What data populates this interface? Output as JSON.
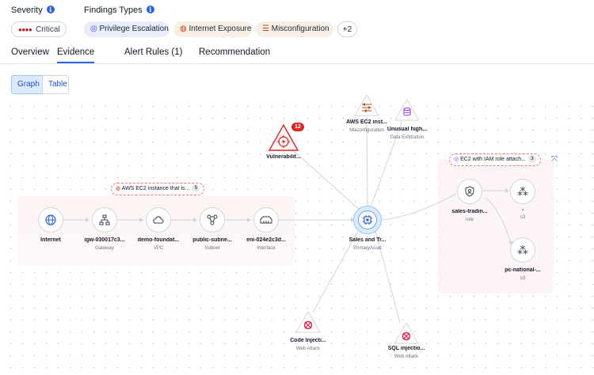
{
  "header": {
    "severity_label": "Severity",
    "findings_label": "Findings Types",
    "severity_value": "Critical",
    "findings": [
      "Privilege Escalation",
      "Internet Exposure",
      "Misconfiguration"
    ],
    "more_count": "+2"
  },
  "tabs": [
    "Overview",
    "Evidence",
    "Alert Rules (1)",
    "Recommendation"
  ],
  "active_tab": "Evidence",
  "view_toggle": {
    "graph": "Graph",
    "table": "Table",
    "active": "Graph"
  },
  "graph": {
    "network_group_label": "AWS EC2 instance that is...",
    "network_group_count": "5",
    "iam_group_label": "EC2 with IAM role attach...",
    "iam_group_count": "3",
    "nodes": {
      "internet": {
        "name": "Internet"
      },
      "gateway": {
        "name": "igw-030017c3...",
        "type": "Gateway"
      },
      "vpc": {
        "name": "demo-foundat...",
        "type": "VPC"
      },
      "subnet": {
        "name": "public-subne...",
        "type": "Subnet"
      },
      "interface": {
        "name": "eni-024e2c3d...",
        "type": "Interface"
      },
      "primary": {
        "name": "Sales and Tr...",
        "type": "PrimaryAsset"
      },
      "vulnerability": {
        "name": "Vulnerabilit...",
        "badge": "12"
      },
      "misconfig": {
        "name": "AWS EC2 inst...",
        "type": "Misconfiguration"
      },
      "exfil": {
        "name": "Unusual high...",
        "type": "Data Exfiltration"
      },
      "role": {
        "name": "sales-tradin...",
        "type": "role"
      },
      "s3a": {
        "name": "-",
        "type": "s3"
      },
      "s3b": {
        "name": "pc-national-...",
        "type": "s3"
      },
      "code_injection": {
        "name": "Code Injecti...",
        "type": "Web Attack"
      },
      "sql_injection": {
        "name": "SQL injectio...",
        "type": "Web Attack"
      }
    }
  },
  "colors": {
    "accent": "#2563eb",
    "critical": "#b91c1c",
    "alert": "#dc2626",
    "purple": "#9333ea",
    "pink": "#e11d48"
  }
}
